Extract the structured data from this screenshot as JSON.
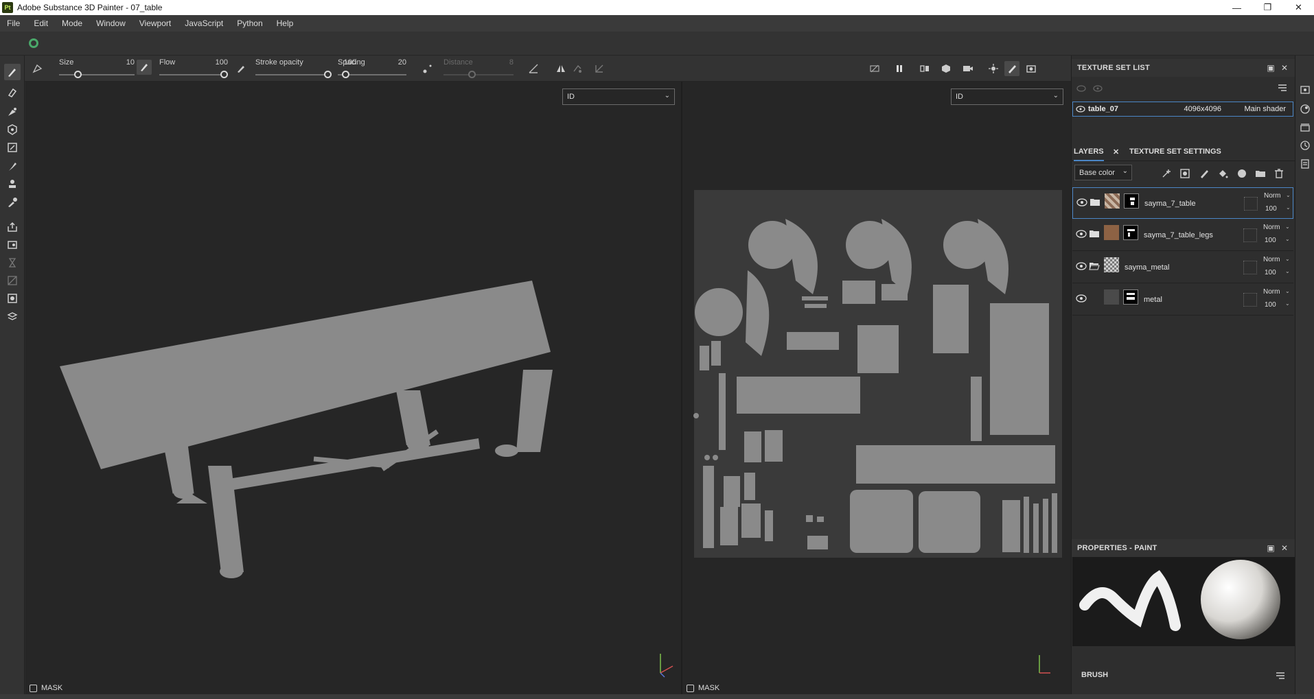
{
  "window": {
    "title": "Adobe Substance 3D Painter - 07_table",
    "app_icon": "Pt",
    "buttons": [
      "minimize-icon",
      "restore-icon",
      "close-icon"
    ]
  },
  "menu": [
    "File",
    "Edit",
    "Mode",
    "Window",
    "Viewport",
    "JavaScript",
    "Python",
    "Help"
  ],
  "tool_options": {
    "size": {
      "label": "Size",
      "value": "10"
    },
    "flow": {
      "label": "Flow",
      "value": "100"
    },
    "stroke_opacity": {
      "label": "Stroke opacity",
      "value": "100"
    },
    "spacing": {
      "label": "Spacing",
      "value": "20"
    },
    "distance": {
      "label": "Distance",
      "value": "8"
    }
  },
  "viewport_3d": {
    "channel": "ID",
    "mask_label": "MASK"
  },
  "viewport_2d": {
    "channel": "ID",
    "mask_label": "MASK"
  },
  "texture_set_list": {
    "title": "TEXTURE SET LIST",
    "item": {
      "name": "table_07",
      "resolution": "4096x4096",
      "shader": "Main shader"
    }
  },
  "layers_panel": {
    "tab_layers": "LAYERS",
    "tab_settings": "TEXTURE SET SETTINGS",
    "channel": "Base color",
    "layers": [
      {
        "name": "sayma_7_table",
        "blend": "Norm",
        "opacity": "100"
      },
      {
        "name": "sayma_7_table_legs",
        "blend": "Norm",
        "opacity": "100"
      },
      {
        "name": "sayma_metal",
        "blend": "Norm",
        "opacity": "100"
      },
      {
        "name": "metal",
        "blend": "Norm",
        "opacity": "100"
      }
    ]
  },
  "properties": {
    "title": "PROPERTIES - PAINT",
    "section": "BRUSH"
  },
  "colors": {
    "accent": "#4b86c6",
    "model_gray": "#8a8a8a",
    "viewport_bg": "#262626"
  }
}
